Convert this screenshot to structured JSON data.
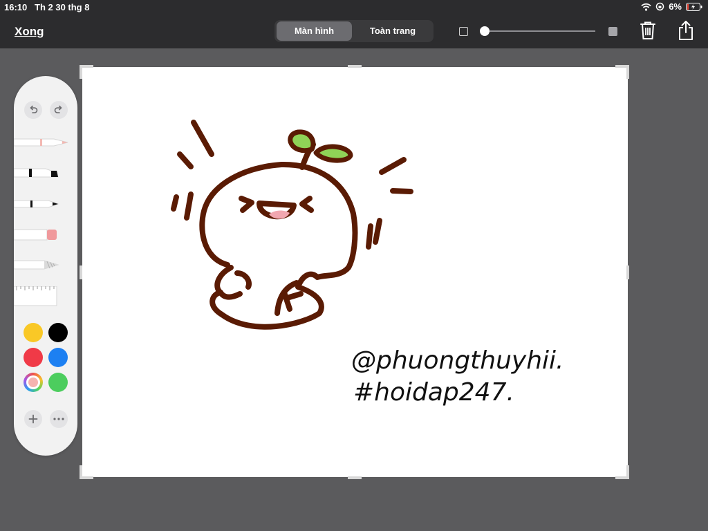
{
  "status": {
    "time": "16:10",
    "date": "Th 2 30 thg 8",
    "battery": "6%"
  },
  "toolbar": {
    "done_label": "Xong",
    "segments": [
      {
        "label": "Màn hình",
        "selected": true
      },
      {
        "label": "Toàn trang",
        "selected": false
      }
    ],
    "opacity_level": 0
  },
  "drawing": {
    "handle_text": "@phuongthuyhii.",
    "tag_text": "#hoidap247."
  },
  "palette": {
    "tools": [
      "pen",
      "marker",
      "pencil",
      "eraser",
      "lasso",
      "ruler"
    ],
    "colors": [
      {
        "name": "yellow",
        "hex": "#f9c826"
      },
      {
        "name": "black",
        "hex": "#000000"
      },
      {
        "name": "red",
        "hex": "#f03a47"
      },
      {
        "name": "blue",
        "hex": "#1d80f2"
      },
      {
        "name": "color-picker",
        "hex": "#f5b3b0"
      },
      {
        "name": "green",
        "hex": "#4ccd5e"
      }
    ]
  },
  "colors": {
    "ink_brown": "#5a1b04",
    "leaf_green": "#8fd357",
    "tongue_pink": "#f1a7b0",
    "toolbar_bg": "#2c2c2e",
    "backdrop": "#5b5b5d"
  }
}
